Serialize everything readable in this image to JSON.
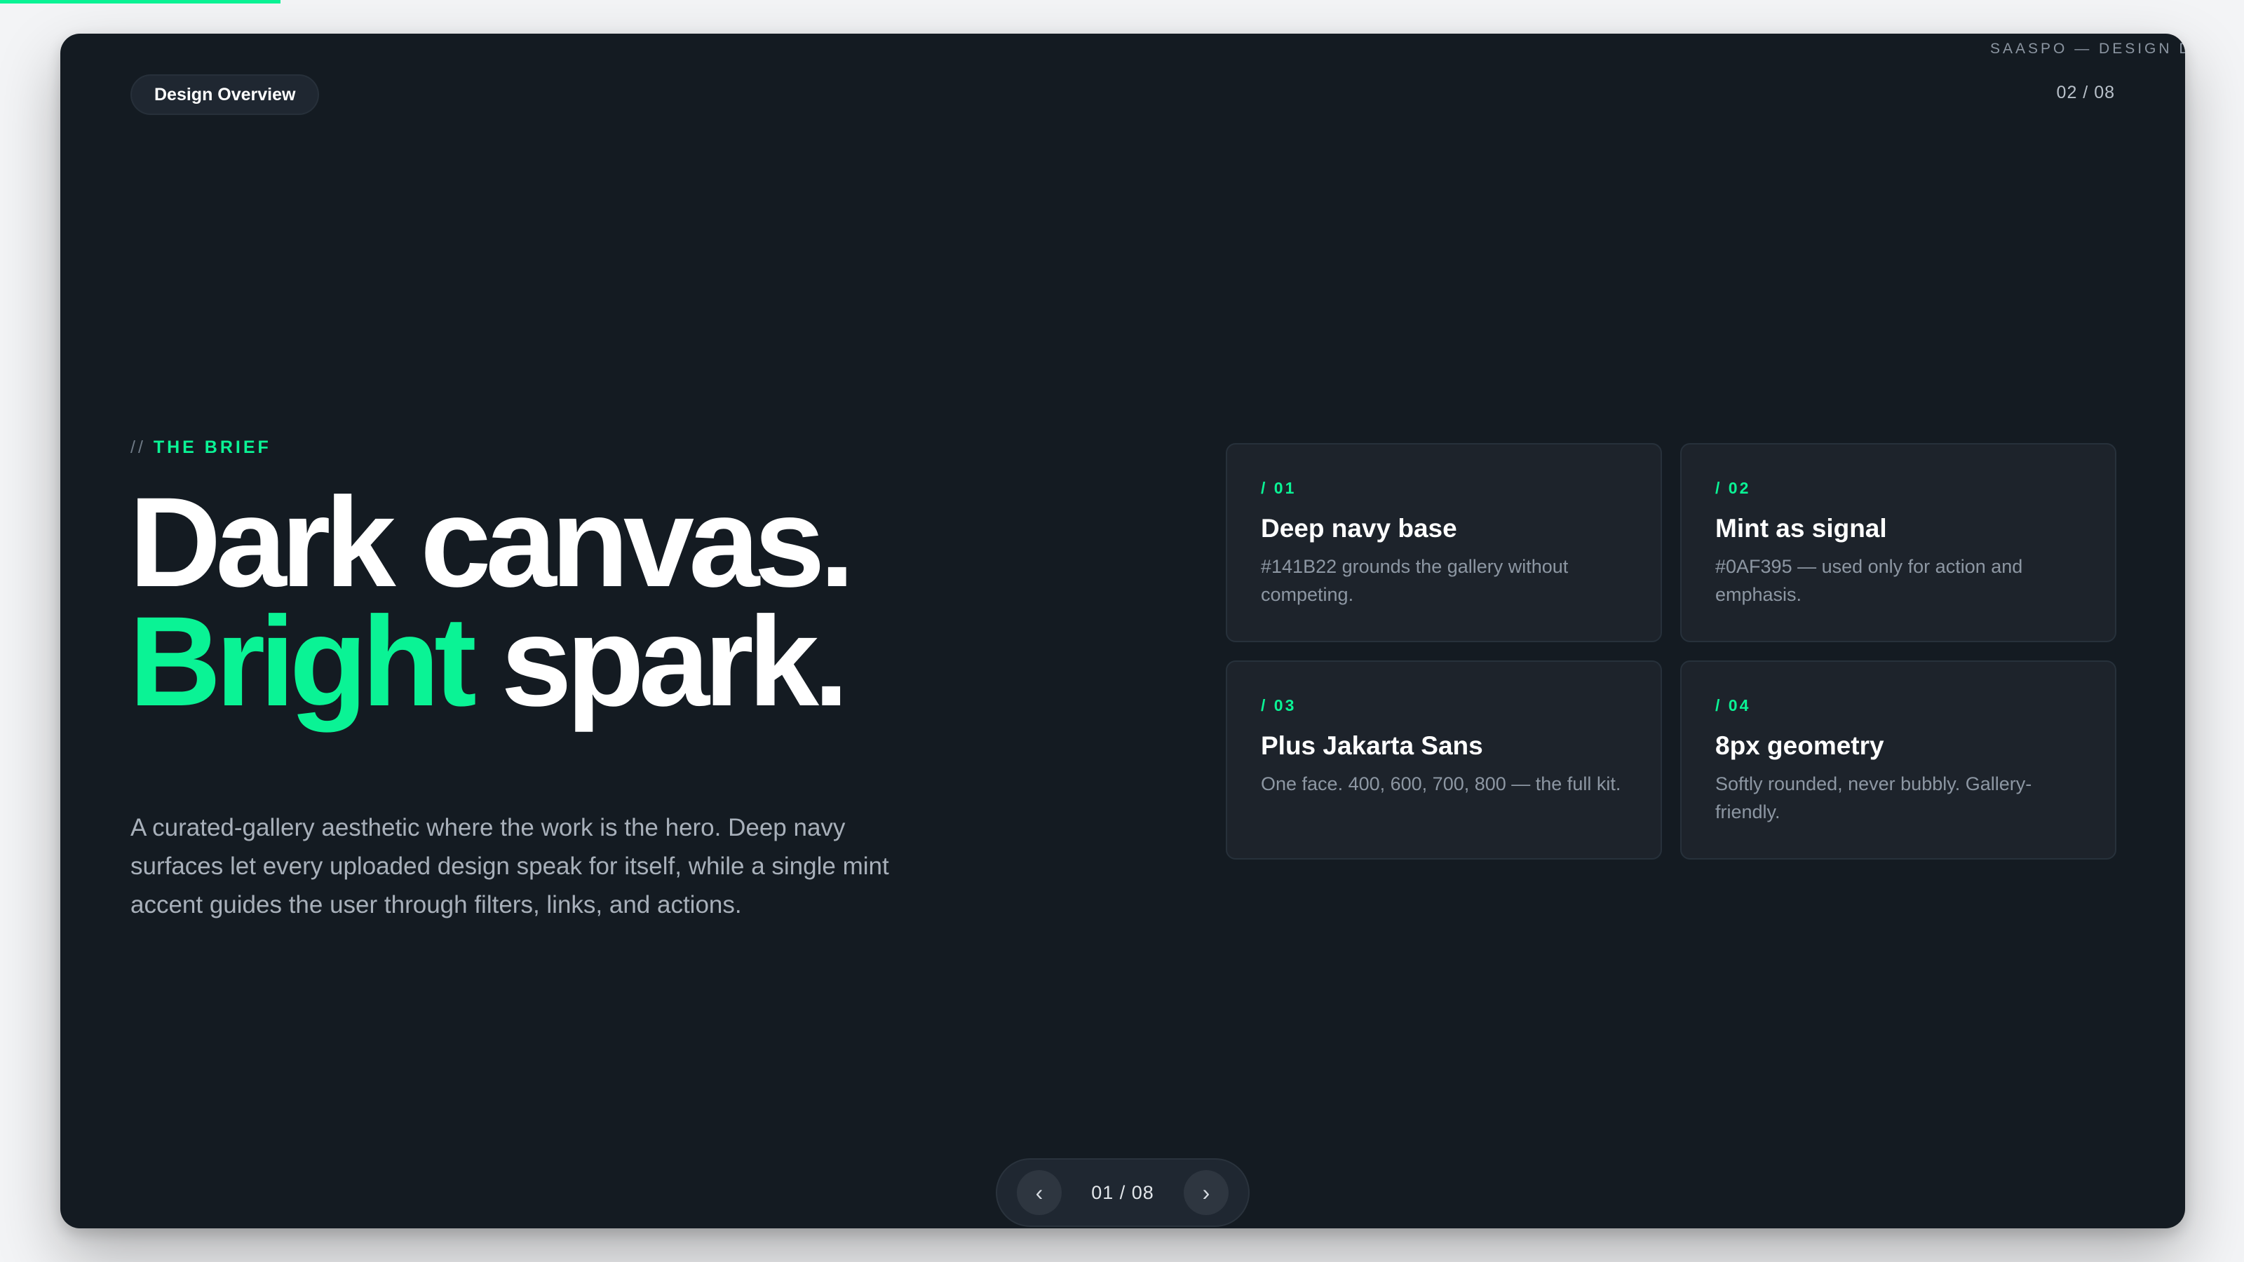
{
  "window": {
    "corner_label": "SAASPO — DESIGN DE",
    "badge_label": "Design Overview",
    "page_indicator": "02 / 08"
  },
  "hero": {
    "eyebrow_prefix": "//",
    "eyebrow_text": "THE BRIEF",
    "headline_line1": "Dark canvas.",
    "headline_accent": "Bright",
    "headline_line2_rest": " spark.",
    "body": "A curated-gallery aesthetic where the work is the hero. Deep navy surfaces let every uploaded design speak for itself, while a single mint accent guides the user through filters, links, and actions."
  },
  "cards": [
    {
      "number": "/ 01",
      "title": "Deep navy base",
      "description": "#141B22 grounds the gallery without competing."
    },
    {
      "number": "/ 02",
      "title": "Mint as signal",
      "description": "#0AF395 — used only for action and emphasis."
    },
    {
      "number": "/ 03",
      "title": "Plus Jakarta Sans",
      "description": "One face. 400, 600, 700, 800 — the full kit."
    },
    {
      "number": "/ 04",
      "title": "8px geometry",
      "description": "Softly rounded, never bubbly. Gallery-friendly."
    }
  ],
  "navigation": {
    "prev_icon": "‹",
    "next_icon": "›",
    "counter": "01 / 08"
  },
  "colors": {
    "background": "#141B22",
    "accent": "#0AF395",
    "card": "#1D232B",
    "text_primary": "#FFFFFF",
    "text_muted": "#A8B0BA"
  }
}
